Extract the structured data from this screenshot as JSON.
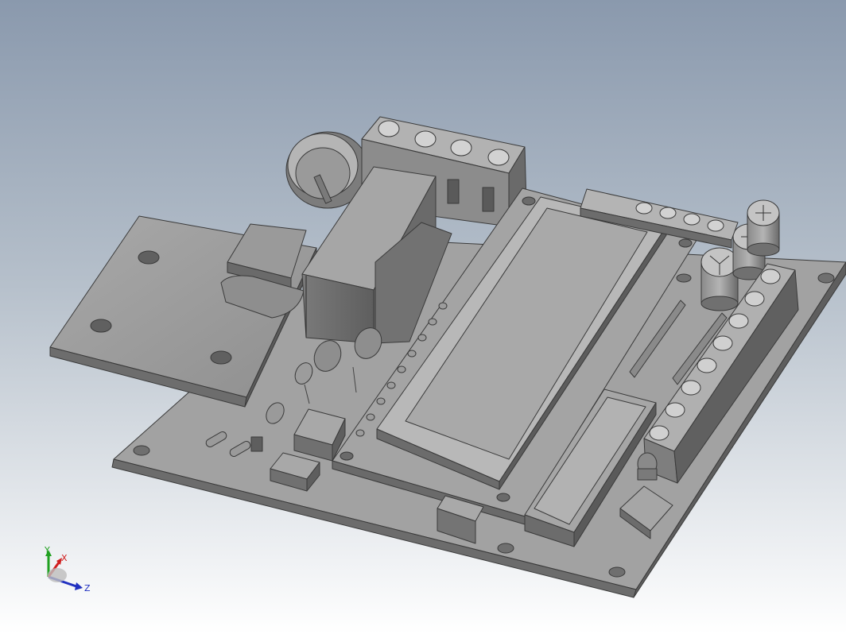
{
  "triad": {
    "y_label": "Y",
    "x_label": "X",
    "z_label": "Z"
  },
  "colors": {
    "background_top": "#8a99ad",
    "background_bottom": "#ffffff",
    "part_grey": "#9a9a9a",
    "edge": "#3a3a3a",
    "axis_x": "#d02020",
    "axis_y": "#20a020",
    "axis_z": "#2030c0"
  }
}
